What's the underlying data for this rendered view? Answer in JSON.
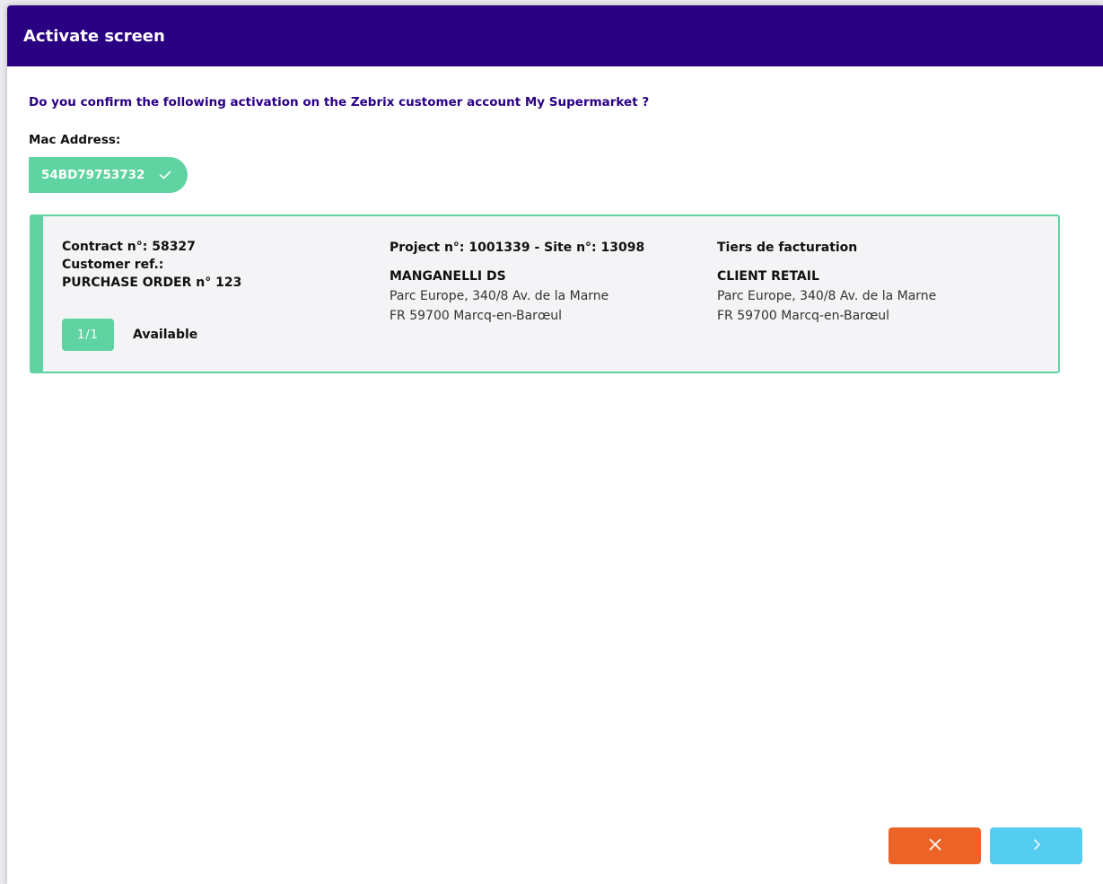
{
  "dialog": {
    "title": "Activate screen",
    "question": "Do you confirm the following activation on the Zebrix customer account My Supermarket ?"
  },
  "mac": {
    "label": "Mac Address:",
    "value": "54BD79753732",
    "status_icon": "check-icon"
  },
  "contract": {
    "contract_line": "Contract n°: 58327",
    "customer_ref_label": "Customer ref.:",
    "customer_ref_value": "PURCHASE ORDER n° 123",
    "availability_count": "1/1",
    "availability_label": "Available",
    "project_line": "Project n°: 1001339 - Site n°: 13098",
    "site_company": "MANGANELLI DS",
    "site_address_line1": "Parc Europe, 340/8 Av. de la Marne",
    "site_address_line2": "FR 59700 Marcq-en-Barœul",
    "billing_title": "Tiers de facturation",
    "billing_company": "CLIENT RETAIL",
    "billing_address_line1": "Parc Europe, 340/8 Av. de la Marne",
    "billing_address_line2": "FR 59700 Marcq-en-Barœul"
  },
  "actions": {
    "cancel_icon": "close-icon",
    "next_icon": "chevron-right-icon"
  },
  "colors": {
    "header": "#2a0082",
    "accent_green": "#5fd3a1",
    "cancel": "#ec6327",
    "next": "#54cdf0"
  }
}
